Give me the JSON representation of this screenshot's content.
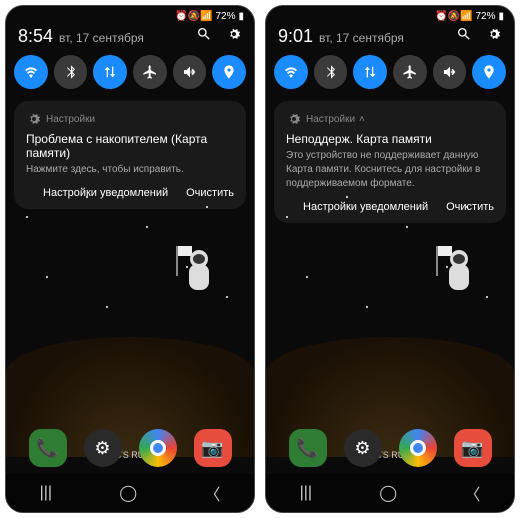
{
  "phones": [
    {
      "status": {
        "battery": "72%",
        "icons": "⏰🔕📶"
      },
      "time": "8:54",
      "date": "вт, 17 сентября",
      "notif": {
        "app": "Настройки",
        "title": "Проблема с накопителем (Карта памяти)",
        "body": "Нажмите здесь, чтобы исправить.",
        "action1": "Настройки уведомлений",
        "action2": "Очистить"
      }
    },
    {
      "status": {
        "battery": "72%",
        "icons": "⏰🔕📶"
      },
      "time": "9:01",
      "date": "вт, 17 сентября",
      "notif": {
        "app": "Настройки",
        "title": "Неподдерж. Карта памяти",
        "body": "Это устройство не поддерживает данную Карта памяти. Коснитесь для настройки в поддерживаемом формате.",
        "action1": "Настройки уведомлений",
        "action2": "Очистить"
      }
    }
  ],
  "carrier": "MTS RUS",
  "qs": [
    {
      "name": "wifi",
      "on": true
    },
    {
      "name": "bluetooth",
      "on": false
    },
    {
      "name": "data",
      "on": true
    },
    {
      "name": "airplane",
      "on": false
    },
    {
      "name": "mute",
      "on": false
    },
    {
      "name": "location",
      "on": true
    }
  ]
}
